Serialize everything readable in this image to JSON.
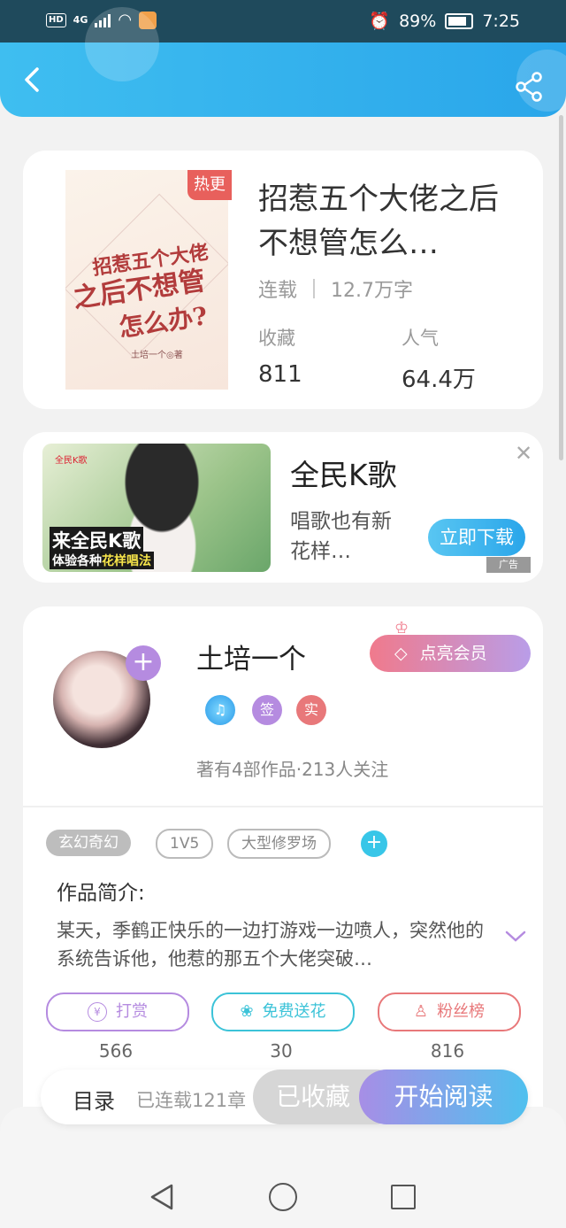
{
  "status_bar": {
    "time": "7:25",
    "battery": "89%",
    "network": "4G",
    "hd": "HD"
  },
  "book": {
    "hot_badge": "热更",
    "title": "招惹五个大佬之后不想管怎么…",
    "status": "连载",
    "word_count": "12.7万字",
    "collect_label": "收藏",
    "collect_value": "811",
    "popularity_label": "人气",
    "popularity_value": "64.4万",
    "cover": {
      "line1": "招惹五个大佬",
      "line2": "之后不想管",
      "line3": "怎么办?",
      "author": "土培一个◎著"
    }
  },
  "ad": {
    "title": "全民K歌",
    "description": "唱歌也有新花样…",
    "button": "立即下载",
    "tag": "广告",
    "image_caption1": "来全民K歌",
    "image_caption2_prefix": "体验各种",
    "image_caption2_highlight": "花样唱法",
    "image_logo": "全民K歌"
  },
  "author": {
    "name": "土培一个",
    "vip_button": "点亮会员",
    "badge_sign": "签",
    "badge_real": "实",
    "stats": "著有4部作品·213人关注"
  },
  "tags": [
    "玄幻奇幻",
    "1V5",
    "大型修罗场"
  ],
  "synopsis": {
    "label": "作品简介:",
    "text": "某天，季鹤正快乐的一边打游戏一边喷人，突然他的系统告诉他，他惹的那五个大佬突破…"
  },
  "actions": [
    {
      "label": "打赏",
      "count": "566",
      "color": "#b58be0"
    },
    {
      "label": "免费送花",
      "count": "30",
      "color": "#3cc3d8"
    },
    {
      "label": "粉丝榜",
      "count": "816",
      "color": "#e8787a"
    }
  ],
  "bottom_bar": {
    "catalog": "目录",
    "chapters": "已连载121章",
    "collected": "已收藏",
    "start_reading": "开始阅读"
  }
}
